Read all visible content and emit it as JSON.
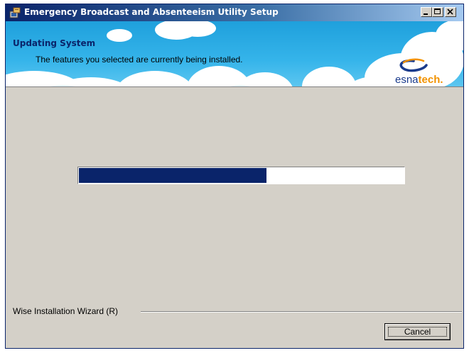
{
  "window": {
    "title": "Emergency Broadcast and Absenteeism Utility Setup",
    "title_icon": "setup-installer-icon",
    "controls": {
      "minimize_icon": "minimize-icon",
      "maximize_icon": "maximize-icon",
      "close_icon": "close-icon"
    }
  },
  "banner": {
    "title": "Updating System",
    "subtitle": "The features you selected are currently being installed.",
    "logo": {
      "part1": "esna",
      "part2": "tech.",
      "icon": "esnatech-swoosh-logo-icon"
    }
  },
  "progress": {
    "fraction": 0.577
  },
  "footer": {
    "label": "Wise Installation Wizard (R)"
  },
  "buttons": {
    "cancel_label": "Cancel"
  },
  "colors": {
    "titlebar_start": "#0a246a",
    "titlebar_end": "#a6caf0",
    "banner_sky": "#35b4ea",
    "banner_title": "#0a246a",
    "progress_fill": "#0a246a",
    "dialog_bg": "#d4d0c8",
    "logo_blue": "#1a3b8c",
    "logo_orange": "#f29200"
  }
}
